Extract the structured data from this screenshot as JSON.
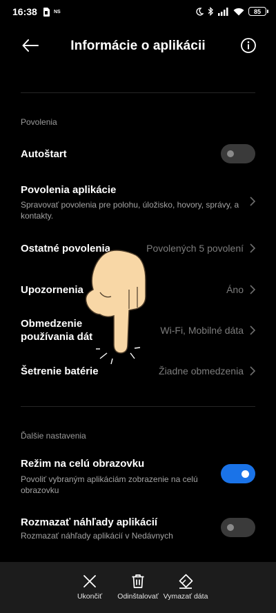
{
  "status_bar": {
    "time": "16:38",
    "ns_label": "NS",
    "battery": "85",
    "icons": [
      "sim-card-icon",
      "moon-icon",
      "bluetooth-icon",
      "signal-icon",
      "wifi-icon",
      "battery-icon"
    ]
  },
  "header": {
    "title": "Informácie o aplikácii",
    "back_icon": "arrow-left-icon",
    "info_icon": "info-icon"
  },
  "sections": {
    "permissions_label": "Povolenia",
    "more_label": "Ďalšie nastavenia"
  },
  "rows": {
    "autostart": {
      "title": "Autoštart",
      "toggle": "off"
    },
    "app_permissions": {
      "title": "Povolenia aplikácie",
      "subtitle": "Spravovať povolenia pre polohu, úložisko, hovory, správy, a kontakty."
    },
    "other_permissions": {
      "title": "Ostatné povolenia",
      "value": "Povolených 5 povolení"
    },
    "notifications": {
      "title": "Upozornenia",
      "value": "Áno"
    },
    "data_usage": {
      "title_line1": "Obmedzenie",
      "title_line2": "používania dát",
      "value": "Wi-Fi, Mobilné dáta"
    },
    "battery_saver": {
      "title": "Šetrenie batérie",
      "value": "Žiadne obmedzenia"
    },
    "fullscreen": {
      "title": "Režim na celú obrazovku",
      "subtitle": "Povoliť vybraným aplikáciám zobrazenie na celú obrazovku",
      "toggle": "on"
    },
    "blur_previews": {
      "title": "Rozmazať náhľady aplikácií",
      "subtitle": "Rozmazať náhľady aplikácií v Nedávnych",
      "toggle": "off"
    }
  },
  "bottom_bar": {
    "force_stop": "Ukončiť",
    "uninstall": "Odinštalovať",
    "clear_data": "Vymazať dáta"
  },
  "colors": {
    "background": "#000000",
    "accent_toggle_on": "#1a73e8",
    "secondary_text": "#7d7d7d",
    "bottom_bar": "#1c1c1c",
    "hand_fill": "#f8d7a6"
  }
}
